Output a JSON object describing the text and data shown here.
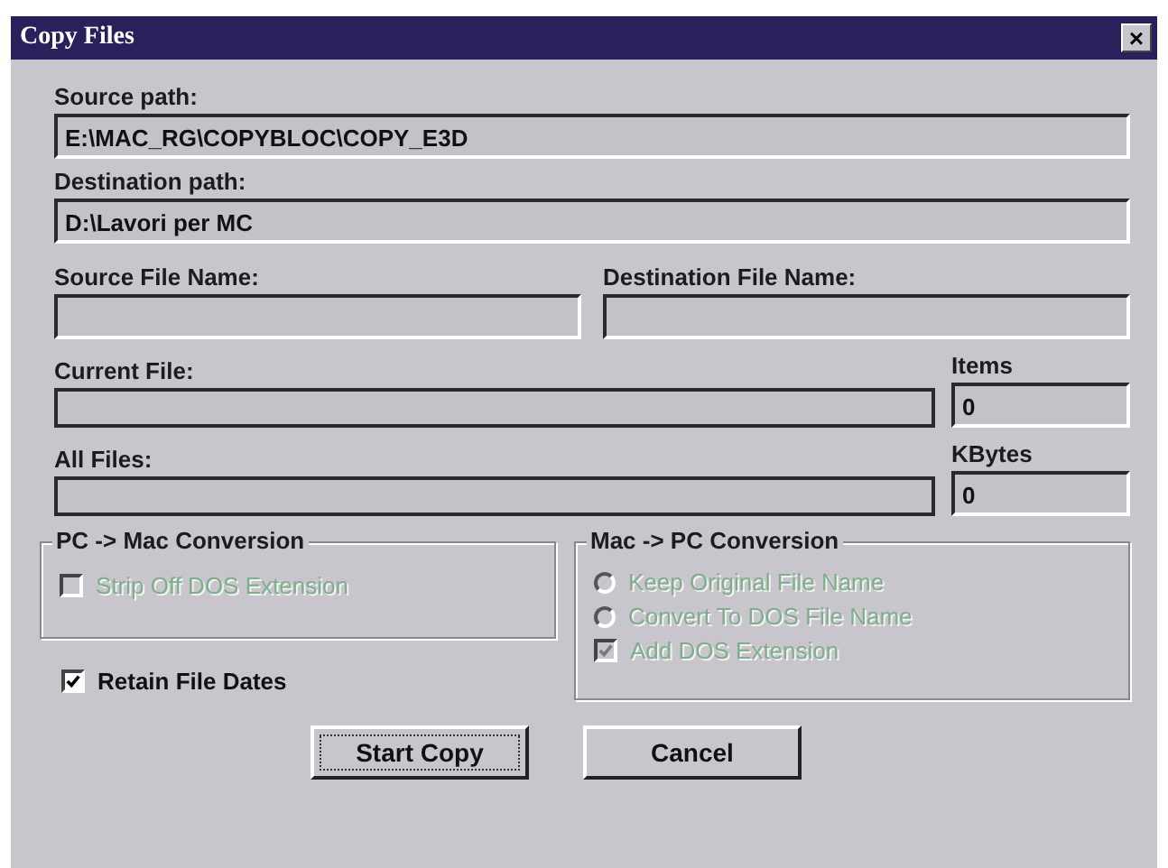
{
  "window": {
    "title": "Copy Files",
    "close": "×"
  },
  "source_path": {
    "label": "Source path:",
    "value": "E:\\MAC_RG\\COPYBLOC\\COPY_E3D"
  },
  "destination_path": {
    "label": "Destination path:",
    "value": "D:\\Lavori per MC"
  },
  "source_file_name": {
    "label": "Source File Name:"
  },
  "destination_file_name": {
    "label": "Destination File Name:"
  },
  "current_file": {
    "label": "Current File:"
  },
  "items": {
    "label": "Items",
    "value": "0"
  },
  "all_files": {
    "label": "All Files:"
  },
  "kbytes": {
    "label": "KBytes",
    "value": "0"
  },
  "pc_to_mac": {
    "title": "PC -> Mac Conversion",
    "options": [
      {
        "kind": "checkbox",
        "label": "Strip Off DOS Extension",
        "checked": false,
        "disabled": true
      }
    ]
  },
  "retain_file_dates": {
    "label": "Retain File Dates",
    "checked": true,
    "disabled": false
  },
  "mac_to_pc": {
    "title": "Mac -> PC Conversion",
    "options": [
      {
        "kind": "radio",
        "label": "Keep Original File Name",
        "selected": false,
        "disabled": true
      },
      {
        "kind": "radio",
        "label": "Convert To DOS File Name",
        "selected": false,
        "disabled": true
      },
      {
        "kind": "checkbox",
        "label": "Add DOS Extension",
        "checked": true,
        "disabled": true
      }
    ]
  },
  "buttons": [
    {
      "label": "Start Copy",
      "default": true
    },
    {
      "label": "Cancel",
      "default": false
    }
  ]
}
